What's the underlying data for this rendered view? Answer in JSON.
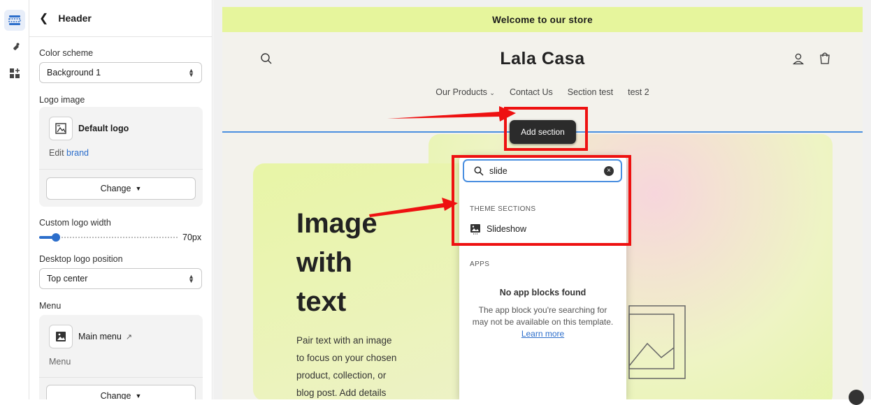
{
  "sidebar_panel": {
    "title": "Header",
    "color_scheme": {
      "label": "Color scheme",
      "value": "Background 1"
    },
    "logo_image": {
      "label": "Logo image",
      "name": "Default logo",
      "edit_prefix": "Edit",
      "edit_link": "brand",
      "change_label": "Change"
    },
    "logo_width": {
      "label": "Custom logo width",
      "value": "70px",
      "fraction": 0.12
    },
    "logo_position": {
      "label": "Desktop logo position",
      "value": "Top center"
    },
    "menu": {
      "label": "Menu",
      "name": "Main menu",
      "sub": "Menu",
      "change_label": "Change"
    }
  },
  "store": {
    "announcement": "Welcome to our store",
    "brand": "Lala Casa",
    "nav": [
      "Our Products",
      "Contact Us",
      "Section test",
      "test 2"
    ],
    "hero": {
      "title_lines": [
        "Image",
        "with",
        "text"
      ],
      "body_lines": [
        "Pair text with an image",
        "to focus on your chosen",
        "product, collection, or",
        "blog post. Add details"
      ]
    }
  },
  "add_section": {
    "button_label": "Add section",
    "search_value": "slide",
    "theme_sections_heading": "THEME SECTIONS",
    "result": "Slideshow",
    "apps_heading": "APPS",
    "empty_title": "No app blocks found",
    "empty_text": "The app block you're searching for may not be available on this template.",
    "learn_more": "Learn more"
  },
  "colors": {
    "accent": "#4a8fe0",
    "announcement_bg": "#e6f59c",
    "highlight": "#ee1111"
  }
}
